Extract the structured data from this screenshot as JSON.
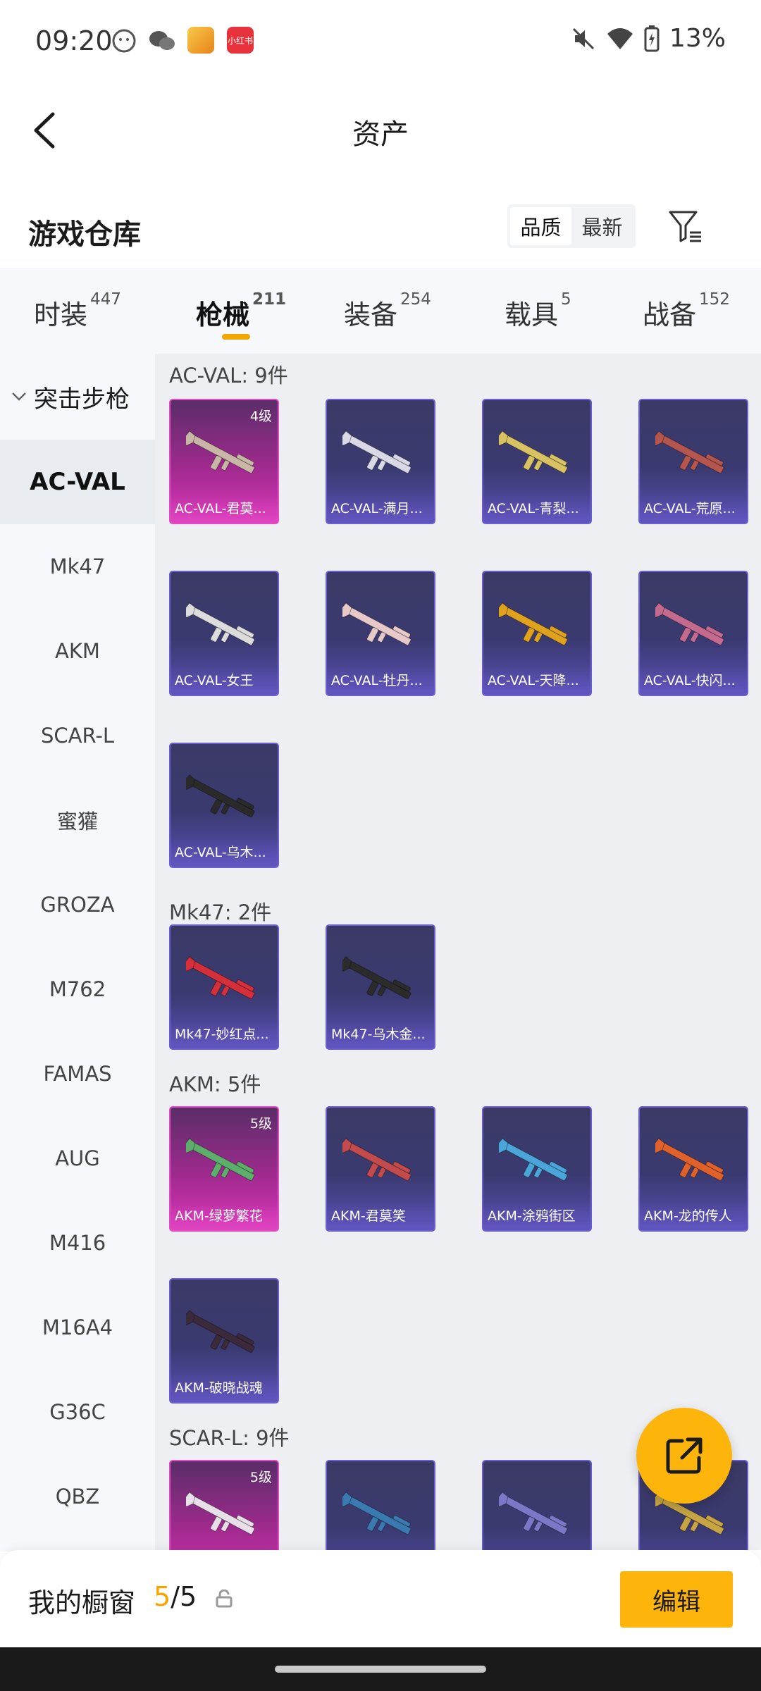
{
  "status_bar": {
    "time": "09:20",
    "battery": "13%",
    "app_icon_1_text": "",
    "app_icon_2_text": "小红书"
  },
  "header": {
    "title": "资产",
    "back_icon": "back-chevron-icon"
  },
  "warehouse": {
    "title": "游戏仓库",
    "sort_options": [
      "品质",
      "最新"
    ],
    "active_sort": "品质",
    "filter_icon": "filter-icon"
  },
  "tabs": [
    {
      "label": "时装",
      "count": "447"
    },
    {
      "label": "枪械",
      "count": "211"
    },
    {
      "label": "装备",
      "count": "254"
    },
    {
      "label": "载具",
      "count": "5"
    },
    {
      "label": "战备",
      "count": "152"
    }
  ],
  "active_tab": "枪械",
  "sidebar": {
    "category": "突击步枪",
    "items": [
      "AC-VAL",
      "Mk47",
      "AKM",
      "SCAR-L",
      "蜜獾",
      "GROZA",
      "M762",
      "FAMAS",
      "AUG",
      "M416",
      "M16A4",
      "G36C",
      "QBZ"
    ],
    "active": "AC-VAL"
  },
  "groups": [
    {
      "title": "AC-VAL: 9件",
      "cards": [
        {
          "name": "AC-VAL-君莫...",
          "level": "4级",
          "tier": "gold",
          "gun": "#c9b6a6"
        },
        {
          "name": "AC-VAL-满月...",
          "level": "",
          "tier": "purple",
          "gun": "#d8d8e6"
        },
        {
          "name": "AC-VAL-青梨...",
          "level": "",
          "tier": "purple",
          "gun": "#d9c261"
        },
        {
          "name": "AC-VAL-荒原...",
          "level": "",
          "tier": "purple",
          "gun": "#b5564e"
        },
        {
          "name": "AC-VAL-女王",
          "level": "",
          "tier": "purple",
          "gun": "#dcdcdc"
        },
        {
          "name": "AC-VAL-牡丹...",
          "level": "",
          "tier": "purple",
          "gun": "#e8c9c9"
        },
        {
          "name": "AC-VAL-天降...",
          "level": "",
          "tier": "purple",
          "gun": "#e0a21c"
        },
        {
          "name": "AC-VAL-快闪...",
          "level": "",
          "tier": "purple",
          "gun": "#c56a8f"
        },
        {
          "name": "AC-VAL-乌木...",
          "level": "",
          "tier": "purple",
          "gun": "#2a2a2a"
        }
      ]
    },
    {
      "title": "Mk47: 2件",
      "cards": [
        {
          "name": "Mk47-妙红点...",
          "level": "",
          "tier": "purple",
          "gun": "#d5303a"
        },
        {
          "name": "Mk47-乌木金...",
          "level": "",
          "tier": "purple",
          "gun": "#2b2b2b"
        }
      ]
    },
    {
      "title": "AKM: 5件",
      "cards": [
        {
          "name": "AKM-绿萝繁花",
          "level": "5级",
          "tier": "gold",
          "gun": "#5cae6a"
        },
        {
          "name": "AKM-君莫笑",
          "level": "",
          "tier": "purple",
          "gun": "#c44b4b"
        },
        {
          "name": "AKM-涂鸦街区",
          "level": "",
          "tier": "purple",
          "gun": "#4aa6d8"
        },
        {
          "name": "AKM-龙的传人",
          "level": "",
          "tier": "purple",
          "gun": "#e0622a"
        },
        {
          "name": "AKM-破晓战魂",
          "level": "",
          "tier": "purple",
          "gun": "#3a2a3a"
        }
      ]
    },
    {
      "title": "SCAR-L: 9件",
      "cards": [
        {
          "name": "",
          "level": "5级",
          "tier": "gold",
          "gun": "#e8e0e8"
        },
        {
          "name": "",
          "level": "",
          "tier": "purple",
          "gun": "#3a7ab0"
        },
        {
          "name": "",
          "level": "",
          "tier": "purple",
          "gun": "#7c78c8"
        },
        {
          "name": "",
          "level": "",
          "tier": "purple",
          "gun": "#c7a544"
        }
      ]
    }
  ],
  "showcase": {
    "label": "我的橱窗",
    "current": "5",
    "total": "/5",
    "edit_label": "编辑",
    "share_icon": "share-icon",
    "lock_icon": "lock-icon"
  },
  "colors": {
    "accent": "#fdb40b",
    "tab_underline": "#f5a400",
    "card_purple": "#3a3a70",
    "card_gold": "#a02a8e"
  }
}
